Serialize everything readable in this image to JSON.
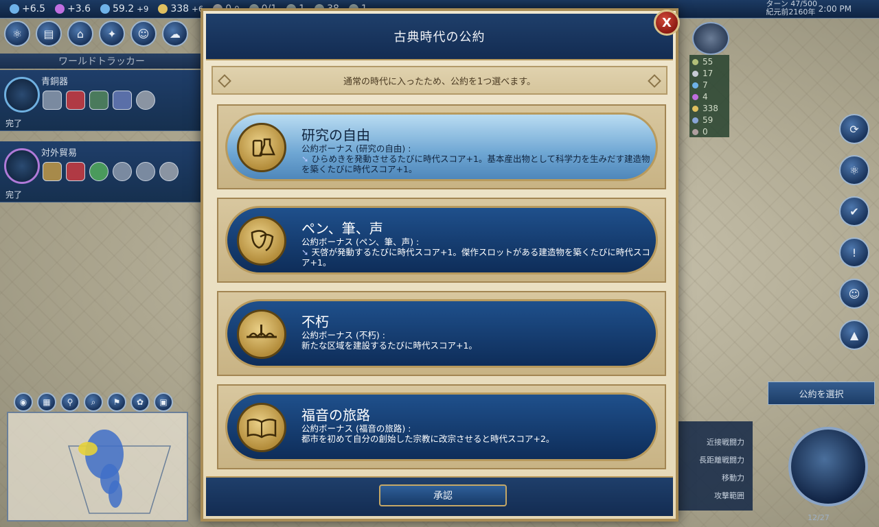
{
  "topbar": {
    "resources": [
      {
        "label": "+6.5",
        "color": "#6fb2e8"
      },
      {
        "label": "+3.6",
        "color": "#c06fe0"
      },
      {
        "label": "59.2",
        "extra": "+9",
        "color": "#6fb2e8"
      },
      {
        "label": "338",
        "extra": "+6",
        "color": "#e0c060"
      },
      {
        "label": "0",
        "extra": "0",
        "color": "#b0b0b0"
      },
      {
        "label": "0/1",
        "color": "#9aa"
      },
      {
        "label": "1",
        "color": "#9aa"
      },
      {
        "label": "38",
        "color": "#9aa"
      },
      {
        "label": "1",
        "color": "#9aa"
      }
    ],
    "turn": "ターン 47/500",
    "year": "紀元前2160年",
    "clock": "2:00 PM"
  },
  "tracker": {
    "header": "ワールドトラッカー",
    "cards": [
      {
        "title": "青銅器",
        "done": "完了"
      },
      {
        "title": "対外貿易",
        "done": "完了"
      }
    ]
  },
  "leader": {
    "stats": [
      "55",
      "17",
      "7",
      "4",
      "338",
      "59",
      "0"
    ]
  },
  "right_panel": {
    "choose_policy": "公約を選択",
    "unit_stats": [
      "近接戦闘力",
      "長距離戦闘力",
      "移動力",
      "攻撃範囲"
    ],
    "turn_counter": "12/27"
  },
  "modal": {
    "title": "古典時代の公約",
    "close_label": "X",
    "instruction": "通常の時代に入ったため、公約を1つ選べます。",
    "policies": [
      {
        "name": "研究の自由",
        "bonus_title": "公約ボーナス (研究の自由) :",
        "bonus_text": "ひらめきを発動させるたびに時代スコア+1。基本産出物として科学力を生みだす建造物を築くたびに時代スコア+1。",
        "icon": "flask-icon"
      },
      {
        "name": "ペン、筆、声",
        "bonus_title": "公約ボーナス (ペン、筆、声) :",
        "bonus_text": "天啓が発動するたびに時代スコア+1。傑作スロットがある建造物を築くたびに時代スコア+1。",
        "icon": "theater-mask-icon"
      },
      {
        "name": "不朽",
        "bonus_title": "公約ボーナス (不朽) :",
        "bonus_text": "新たな区域を建設するたびに時代スコア+1。",
        "icon": "bridge-icon"
      },
      {
        "name": "福音の旅路",
        "bonus_title": "公約ボーナス (福音の旅路) :",
        "bonus_text": "都市を初めて自分の創始した宗教に改宗させると時代スコア+2。",
        "icon": "book-icon"
      }
    ],
    "accept_label": "承認"
  }
}
